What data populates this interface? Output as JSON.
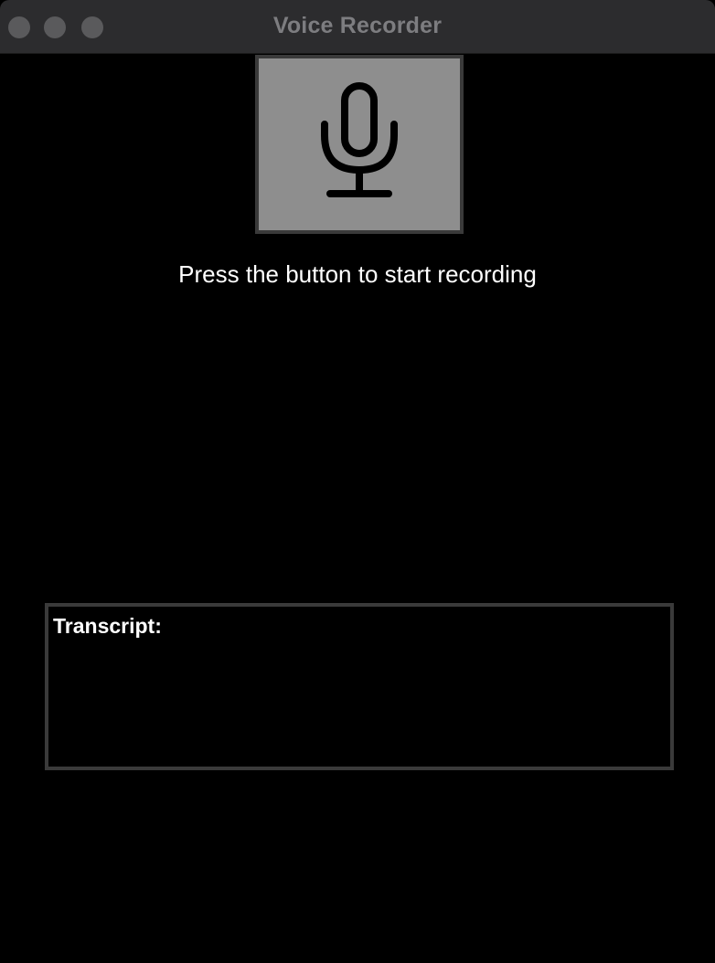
{
  "window": {
    "title": "Voice Recorder"
  },
  "recorder": {
    "button_icon": "microphone-icon",
    "status_text": "Press the button to start recording"
  },
  "transcript": {
    "label": "Transcript:",
    "text": ""
  },
  "colors": {
    "background": "#000000",
    "titlebar": "#2c2c2e",
    "button_fill": "#8e8e8e",
    "button_border": "#3a3a3a",
    "text": "#ffffff"
  }
}
